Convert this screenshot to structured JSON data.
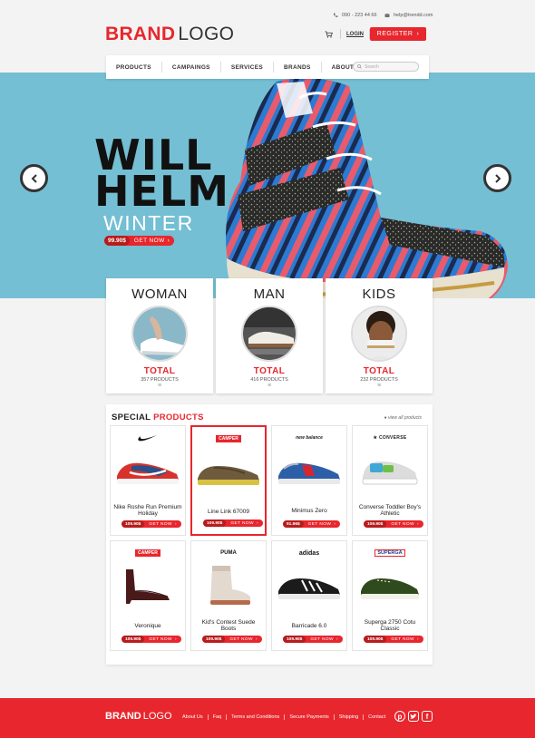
{
  "header": {
    "logo_bold": "BRAND",
    "logo_light": "LOGO",
    "phone": "090 - 223 44 66",
    "email": "help@trendd.com",
    "login_label": "LOGIN",
    "register_label": "REGISTER"
  },
  "nav": {
    "items": [
      "PRODUCTS",
      "CAMPAINGS",
      "SERVICES",
      "BRANDS",
      "ABOUT US"
    ],
    "search_placeholder": "Search"
  },
  "hero": {
    "title_line1": "WILL",
    "title_line2": "HELM",
    "subtitle": "WINTER",
    "price": "99.90$",
    "cta": "GET NOW"
  },
  "categories": [
    {
      "name": "WOMAN",
      "total_label": "TOTAL",
      "count": "357 PRODUCTS"
    },
    {
      "name": "MAN",
      "total_label": "TOTAL",
      "count": "416 PRODUCTS"
    },
    {
      "name": "KIDS",
      "total_label": "TOTAL",
      "count": "232 PRODUCTS"
    }
  ],
  "special": {
    "title_a": "SPECIAL",
    "title_b": "PRODUCTS",
    "view_all": "view all products"
  },
  "products": [
    {
      "brand": "nike",
      "name": "Nike Roshe Run Premium Holiday",
      "price": "109.90$",
      "cta": "GET NOW"
    },
    {
      "brand": "CAMPER",
      "name": "Line Link 67009",
      "price": "109.90$",
      "cta": "GET NOW"
    },
    {
      "brand": "new balance",
      "name": "Minimus Zero",
      "price": "91.96$",
      "cta": "GET NOW"
    },
    {
      "brand": "CONVERSE",
      "name": "Converse  Toddler Boy's Athletic",
      "price": "109.90$",
      "cta": "GET NOW"
    },
    {
      "brand": "CAMPER",
      "name": "Veronique",
      "price": "109.90$",
      "cta": "GET NOW"
    },
    {
      "brand": "PUMA",
      "name": "Kid's Contest Suede Boots",
      "price": "109.90$",
      "cta": "GET NOW"
    },
    {
      "brand": "adidas",
      "name": "Barricade 6.0",
      "price": "109.90$",
      "cta": "GET NOW"
    },
    {
      "brand": "SUPERGA",
      "name": "Superga 2750 Cotu Classic",
      "price": "109.90$",
      "cta": "GET NOW"
    }
  ],
  "footer": {
    "logo_bold": "BRAND",
    "logo_light": "LOGO",
    "links": [
      "About Us",
      "Faq",
      "Terms and Conditions",
      "Secure Payments",
      "Shipping",
      "Contact"
    ]
  },
  "colors": {
    "accent": "#e8262d",
    "hero_bg": "#74bfd3",
    "page_bg": "#f3f3f3"
  }
}
